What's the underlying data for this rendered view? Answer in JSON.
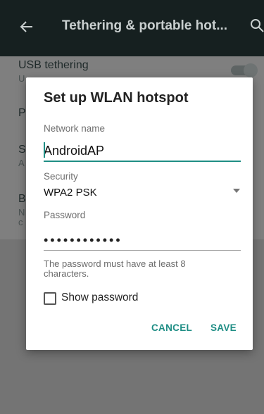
{
  "appbar": {
    "title": "Tethering & portable hot...",
    "back_icon": "arrow-back-icon",
    "search_icon": "search-icon"
  },
  "background_rows": {
    "usb_title": "USB tethering",
    "usb_sub": "U",
    "row2_title": "P",
    "row3_title": "S",
    "row3_sub": "A",
    "row4_title": "B",
    "row4_sub": "N",
    "row4_sub2": "c"
  },
  "dialog": {
    "title": "Set up WLAN hotspot",
    "network_name_label": "Network name",
    "network_name_value": "AndroidAP",
    "security_label": "Security",
    "security_value": "WPA2 PSK",
    "password_label": "Password",
    "password_value": "••••••••••••",
    "hint": "The password must have at least 8 characters.",
    "show_password_label": "Show password",
    "show_password_checked": false,
    "cancel_label": "CANCEL",
    "save_label": "SAVE"
  },
  "colors": {
    "accent": "#1f8e85",
    "appbar": "#162020"
  }
}
